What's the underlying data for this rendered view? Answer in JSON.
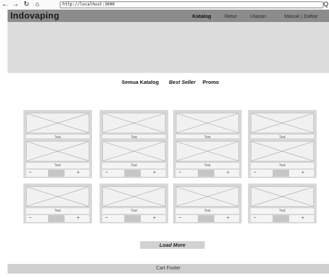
{
  "browser": {
    "url": "http://localhost:3000",
    "back_icon": "←",
    "forward_icon": "→",
    "reload_icon": "↻",
    "home_icon": "⌂",
    "search_icon": "Q"
  },
  "header": {
    "brand": "Indovaping",
    "nav": [
      {
        "label": "Katalog",
        "active": true
      },
      {
        "label": "Retur",
        "active": false
      },
      {
        "label": "Ulasan",
        "active": false
      },
      {
        "label": "Masuk | Daftar",
        "active": false
      }
    ]
  },
  "tabs": [
    {
      "label": "Semua Katalog"
    },
    {
      "label": "Best Seller"
    },
    {
      "label": "Promo"
    }
  ],
  "products": [
    {
      "label": "Text",
      "minus": "−",
      "plus": "+"
    },
    {
      "label": "Text",
      "minus": "−",
      "plus": "+"
    },
    {
      "label": "Text",
      "minus": "−",
      "plus": "+"
    },
    {
      "label": "Text",
      "minus": "−",
      "plus": "+"
    },
    {
      "label": "Text",
      "minus": "−",
      "plus": "+"
    },
    {
      "label": "Text",
      "minus": "−",
      "plus": "+"
    },
    {
      "label": "Text",
      "minus": "−",
      "plus": "+"
    },
    {
      "label": "Text",
      "minus": "−",
      "plus": "+"
    },
    {
      "label": "Text",
      "minus": "−",
      "plus": "+"
    },
    {
      "label": "Text",
      "minus": "−",
      "plus": "+"
    },
    {
      "label": "Text",
      "minus": "−",
      "plus": "+"
    },
    {
      "label": "Text",
      "minus": "−",
      "plus": "+"
    }
  ],
  "load_more": "Load More",
  "footer": "Cart Footer"
}
